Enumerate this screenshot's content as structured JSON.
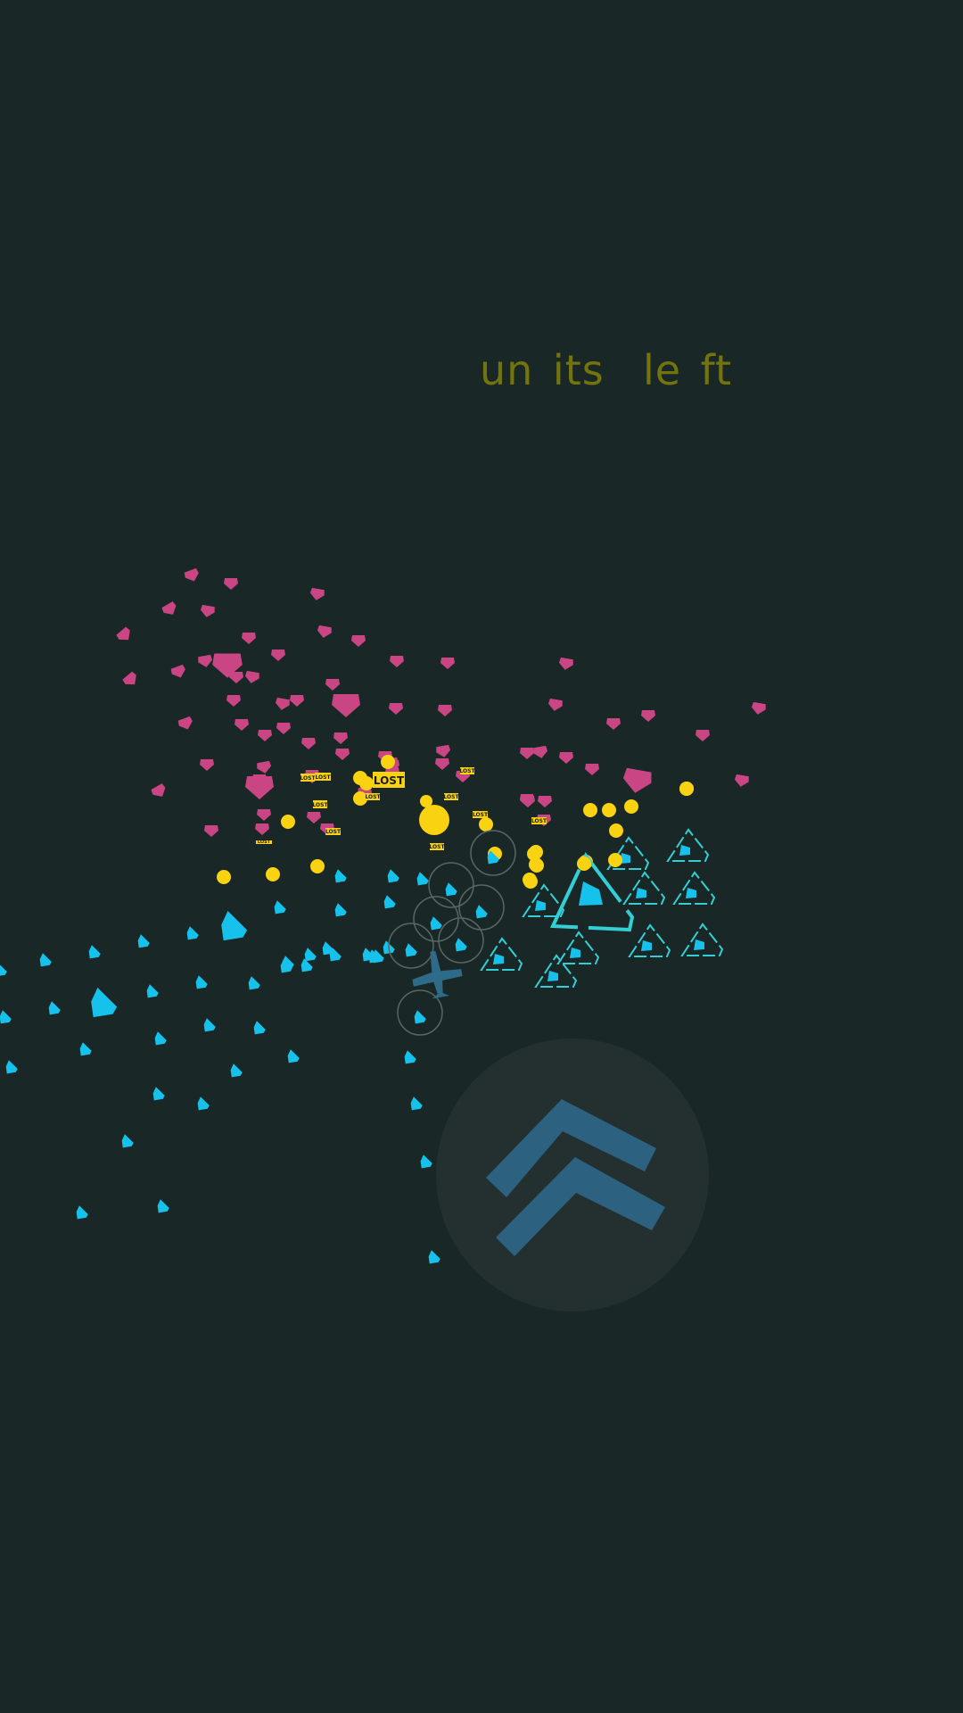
{
  "hud": {
    "units_left_text": "un its  le ft"
  },
  "colors": {
    "background": "#192826",
    "ally": "#16c2ec",
    "ally_selected_ring": "#33cfd6",
    "enemy": "#c94584",
    "casualty_marker": "#f9d311",
    "hud_text": "#73740e",
    "selection_circle": "#5a6664",
    "command_unit": "#2e6b88",
    "advance_button_bg": "#23302f",
    "advance_button_icon": "#2c6180"
  },
  "lost_tag": {
    "label": "LOST"
  },
  "advance_button": {
    "icon": "double-chevron-up-icon"
  }
}
